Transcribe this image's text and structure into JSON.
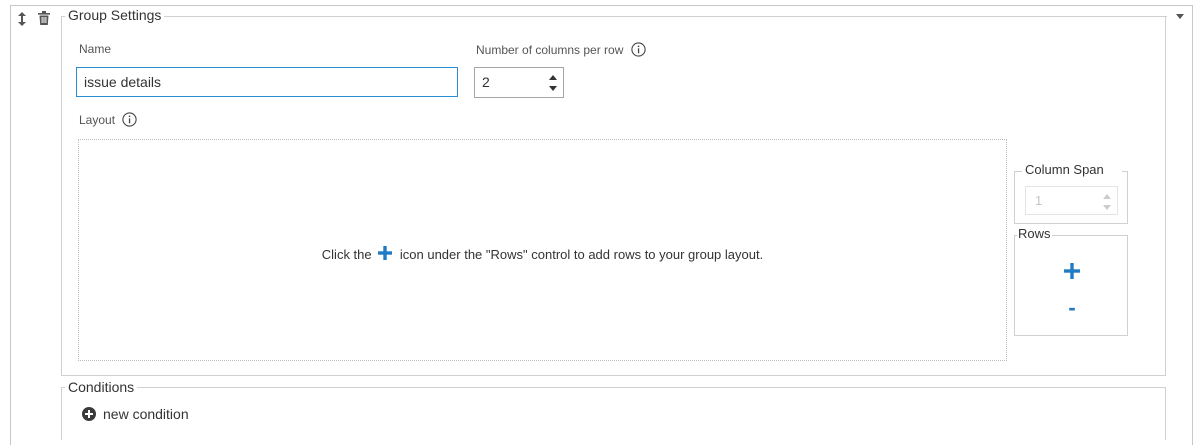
{
  "group_settings": {
    "legend": "Group Settings",
    "name_label": "Name",
    "name_value": "issue details",
    "columns_label": "Number of columns per row",
    "columns_value": "2",
    "layout_label": "Layout",
    "layout_message_prefix": "Click the",
    "layout_message_suffix": "icon under the \"Rows\" control to add rows to your group layout."
  },
  "column_span": {
    "legend": "Column Span",
    "value": "1"
  },
  "rows": {
    "legend": "Rows",
    "add_label": "+",
    "remove_label": "-"
  },
  "conditions": {
    "legend": "Conditions",
    "new_condition_label": "new condition"
  },
  "icons": {
    "handle": "sort-handle-icon",
    "trash": "trash-icon",
    "collapse": "caret-down-icon",
    "info": "info-icon",
    "plus": "plus-icon",
    "plus_circle": "plus-circle-icon"
  },
  "colors": {
    "accent": "#1e7bc4",
    "input_focus_border": "#2a8dd4",
    "border": "#d0d0d0"
  }
}
